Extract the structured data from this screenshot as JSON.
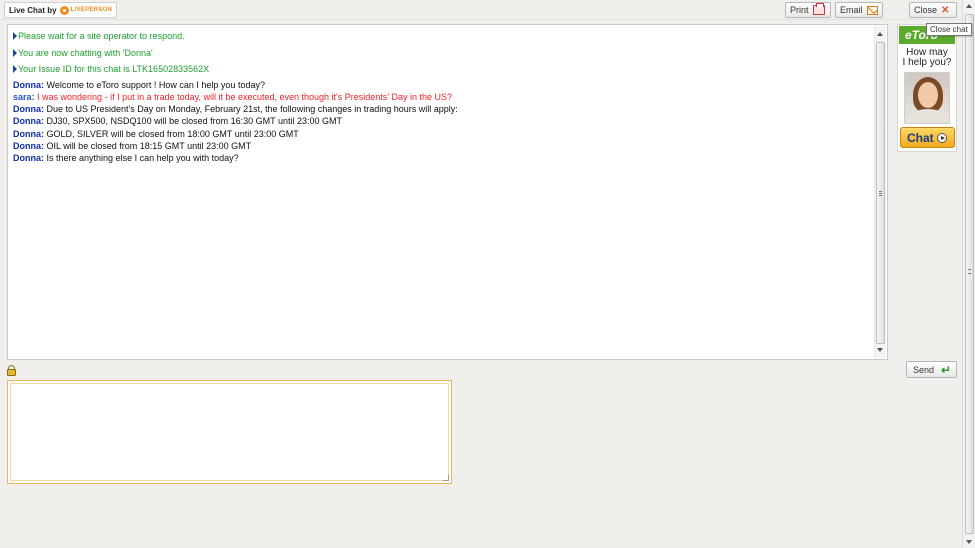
{
  "header": {
    "powered_by": "Live Chat by",
    "powered_brand": "LIVEPERSON",
    "print_label": "Print",
    "email_label": "Email",
    "close_label": "Close",
    "close_tooltip": "Close chat"
  },
  "system_messages": [
    "Please wait for a site operator to respond.",
    "You are now chatting with 'Donna'",
    "Your Issue ID for this chat is LTK16502833562X"
  ],
  "messages": [
    {
      "sender": "Donna:",
      "role": "operator",
      "text": "Welcome to eToro support ! How can I help you today?"
    },
    {
      "sender": "sara:",
      "role": "visitor",
      "text": "I was wondering - if I put in a trade today, will it be executed, even though it's Presidents' Day in the US?"
    },
    {
      "sender": "Donna:",
      "role": "operator",
      "text": "Due to US President's Day on Monday, February 21st, the following changes in trading hours will apply:"
    },
    {
      "sender": "Donna:",
      "role": "operator",
      "text": "DJ30, SPX500, NSDQ100 will be closed from 16:30 GMT until 23:00 GMT"
    },
    {
      "sender": "Donna:",
      "role": "operator",
      "text": "GOLD, SILVER will be closed from 18:00 GMT until 23:00 GMT"
    },
    {
      "sender": "Donna:",
      "role": "operator",
      "text": "OIL will be closed from 18:15 GMT until 23:00 GMT"
    },
    {
      "sender": "Donna:",
      "role": "operator",
      "text": "Is there anything else I can help you with today?"
    }
  ],
  "ad": {
    "logo": "eToro",
    "line1": "How may",
    "line2": "I help you?",
    "chat_label": "Chat"
  },
  "composer": {
    "value": "",
    "send_label": "Send"
  },
  "icons": {
    "print": "printer-icon",
    "email": "envelope-icon",
    "close": "close-icon",
    "send": "enter-arrow-icon",
    "lock": "lock-icon"
  },
  "colors": {
    "system_text": "#1e9e2e",
    "operator_name": "#0e2ea8",
    "visitor_name": "#2a54c6",
    "visitor_text": "#e8232a",
    "input_border": "#e7b75a"
  }
}
